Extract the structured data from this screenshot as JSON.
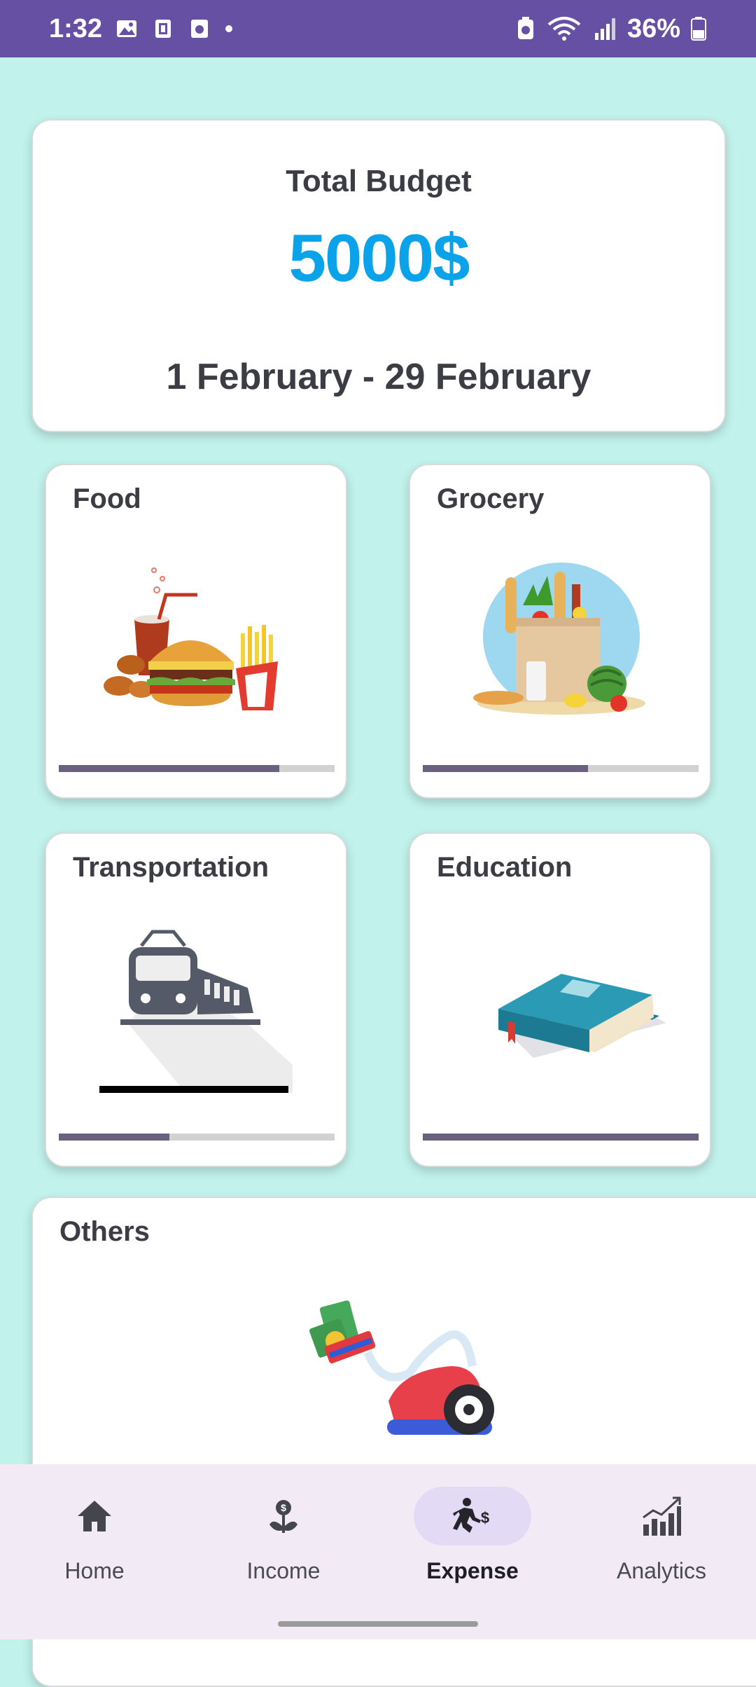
{
  "status_bar": {
    "time": "1:32",
    "battery": "36%"
  },
  "budget": {
    "title": "Total Budget",
    "amount": "5000$",
    "range": "1 February - 29 February"
  },
  "categories": [
    {
      "label": "Food",
      "progress": 0.8
    },
    {
      "label": "Grocery",
      "progress": 0.6
    },
    {
      "label": "Transportation",
      "progress": 0.4
    },
    {
      "label": "Education",
      "progress": 1.0
    }
  ],
  "others": {
    "label": "Others"
  },
  "nav": [
    {
      "label": "Home",
      "icon": "home-icon"
    },
    {
      "label": "Income",
      "icon": "income-icon"
    },
    {
      "label": "Expense",
      "icon": "expense-icon",
      "active": true
    },
    {
      "label": "Analytics",
      "icon": "analytics-icon"
    }
  ],
  "colors": {
    "status_bar": "#6650a4",
    "background": "#c2f2ec",
    "amount": "#0aa3ea",
    "progress_fill": "#6a6180",
    "nav_active_pill": "#e3daf5"
  }
}
